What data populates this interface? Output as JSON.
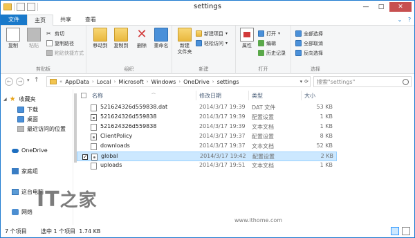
{
  "window": {
    "title": "settings"
  },
  "tabs": {
    "file": "文件",
    "home": "主页",
    "share": "共享",
    "view": "查看"
  },
  "ribbon": {
    "clipboard": {
      "label": "剪贴板",
      "copy": "复制",
      "paste": "粘贴",
      "cut": "剪切",
      "copy_path": "复制路径",
      "paste_shortcut": "粘贴快捷方式"
    },
    "organize": {
      "label": "组织",
      "move_to": "移动到",
      "copy_to": "复制到",
      "delete": "删除",
      "rename": "重命名"
    },
    "new": {
      "label": "新建",
      "new_folder": "新建\n文件夹",
      "new_item": "新建项目",
      "easy_access": "轻松访问"
    },
    "open": {
      "label": "打开",
      "properties": "属性",
      "open": "打开",
      "edit": "编辑",
      "history": "历史记录"
    },
    "select": {
      "label": "选择",
      "select_all": "全部选择",
      "select_none": "全部取消",
      "invert": "反向选择"
    }
  },
  "address": {
    "crumbs": [
      "AppData",
      "Local",
      "Microsoft",
      "Windows",
      "OneDrive",
      "settings"
    ],
    "overflow": "«"
  },
  "search": {
    "placeholder": "搜索\"settings\""
  },
  "nav": {
    "favorites": "收藏夹",
    "downloads": "下载",
    "desktop": "桌面",
    "recent": "最近访问的位置",
    "onedrive": "OneDrive",
    "homegroup": "家庭组",
    "thispc": "这台电脑",
    "network": "网络"
  },
  "columns": {
    "name": "名称",
    "modified": "修改日期",
    "type": "类型",
    "size": "大小"
  },
  "files": [
    {
      "name": "521624326d559838.dat",
      "date": "2014/3/17 19:39",
      "type": "DAT 文件",
      "size": "53 KB",
      "kind": "paper",
      "selected": false
    },
    {
      "name": "521624326d559838",
      "date": "2014/3/17 19:39",
      "type": "配置设置",
      "size": "1 KB",
      "kind": "cfg",
      "selected": false
    },
    {
      "name": "521624326d559838",
      "date": "2014/3/17 19:39",
      "type": "文本文档",
      "size": "1 KB",
      "kind": "paper",
      "selected": false
    },
    {
      "name": "ClientPolicy",
      "date": "2014/3/17 19:37",
      "type": "配置设置",
      "size": "8 KB",
      "kind": "cfg",
      "selected": false
    },
    {
      "name": "downloads",
      "date": "2014/3/17 19:37",
      "type": "文本文档",
      "size": "52 KB",
      "kind": "paper",
      "selected": false
    },
    {
      "name": "global",
      "date": "2014/3/17 19:42",
      "type": "配置设置",
      "size": "2 KB",
      "kind": "cfg",
      "selected": true
    },
    {
      "name": "uploads",
      "date": "2014/3/17 19:51",
      "type": "文本文档",
      "size": "1 KB",
      "kind": "paper",
      "selected": false
    }
  ],
  "status": {
    "count": "7 个项目",
    "selection": "选中 1 个项目  1.74 KB"
  },
  "watermark": {
    "logo": "IT之家",
    "url": "www.ithome.com"
  },
  "colors": {
    "accent": "#1979ca",
    "selection": "#cce8ff",
    "close": "#c75050"
  }
}
